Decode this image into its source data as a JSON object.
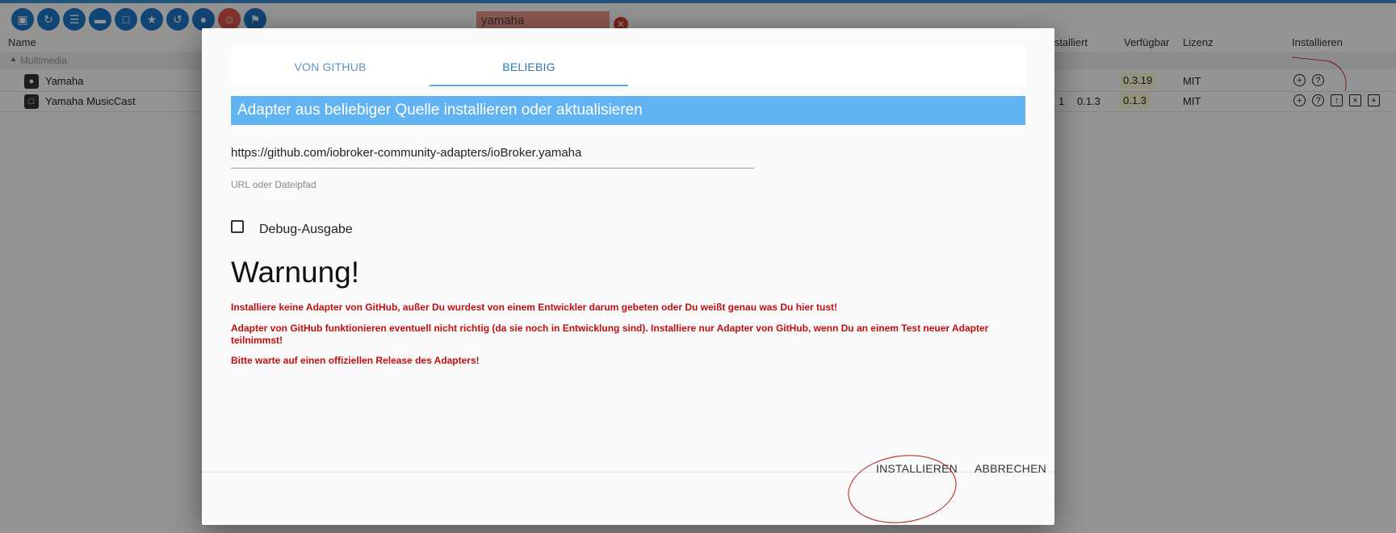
{
  "toolbar": {
    "icons": [
      "▣",
      "↻",
      "☰",
      "▬",
      "□",
      "★",
      "↺",
      "●",
      "☺",
      "⚑"
    ]
  },
  "search": {
    "value": "yamaha",
    "clear_icon": "✕"
  },
  "table": {
    "headers": {
      "name": "Name",
      "installed": "Installiert",
      "available": "Verfügbar",
      "license": "Lizenz",
      "install": "Installieren"
    },
    "group": "Multimedia",
    "rows": [
      {
        "name": "Yamaha",
        "installed": "",
        "installed_version": "",
        "available": "0.3.19",
        "license": "MIT"
      },
      {
        "name": "Yamaha MusicCast",
        "installed": "1",
        "installed_version": "0.1.3",
        "available": "0.1.3",
        "license": "MIT"
      }
    ]
  },
  "dialog": {
    "tabs": [
      {
        "label": "VON GITHUB",
        "active": false
      },
      {
        "label": "BELIEBIG",
        "active": true
      }
    ],
    "banner": "Adapter aus beliebiger Quelle installieren oder aktualisieren",
    "url": {
      "value": "https://github.com/iobroker-community-adapters/ioBroker.yamaha",
      "label": "URL oder Dateipfad"
    },
    "debug": {
      "label": "Debug-Ausgabe",
      "checked": false
    },
    "warning": {
      "title": "Warnung!",
      "lines": [
        "Installiere keine Adapter von GitHub, außer Du wurdest von einem Entwickler darum gebeten oder Du weißt genau was Du hier tust!",
        "Adapter von GitHub funktionieren eventuell nicht richtig (da sie noch in Entwicklung sind). Installiere nur Adapter von GitHub, wenn Du an einem Test neuer Adapter teilnimmst!",
        "Bitte warte auf einen offiziellen Release des Adapters!"
      ]
    },
    "buttons": {
      "install": "INSTALLIEREN",
      "cancel": "ABBRECHEN"
    }
  },
  "colors": {
    "accent": "#62b3f2",
    "toolbar": "#1e78c8",
    "warning": "#c40d0d",
    "annotation": "#b81616"
  }
}
